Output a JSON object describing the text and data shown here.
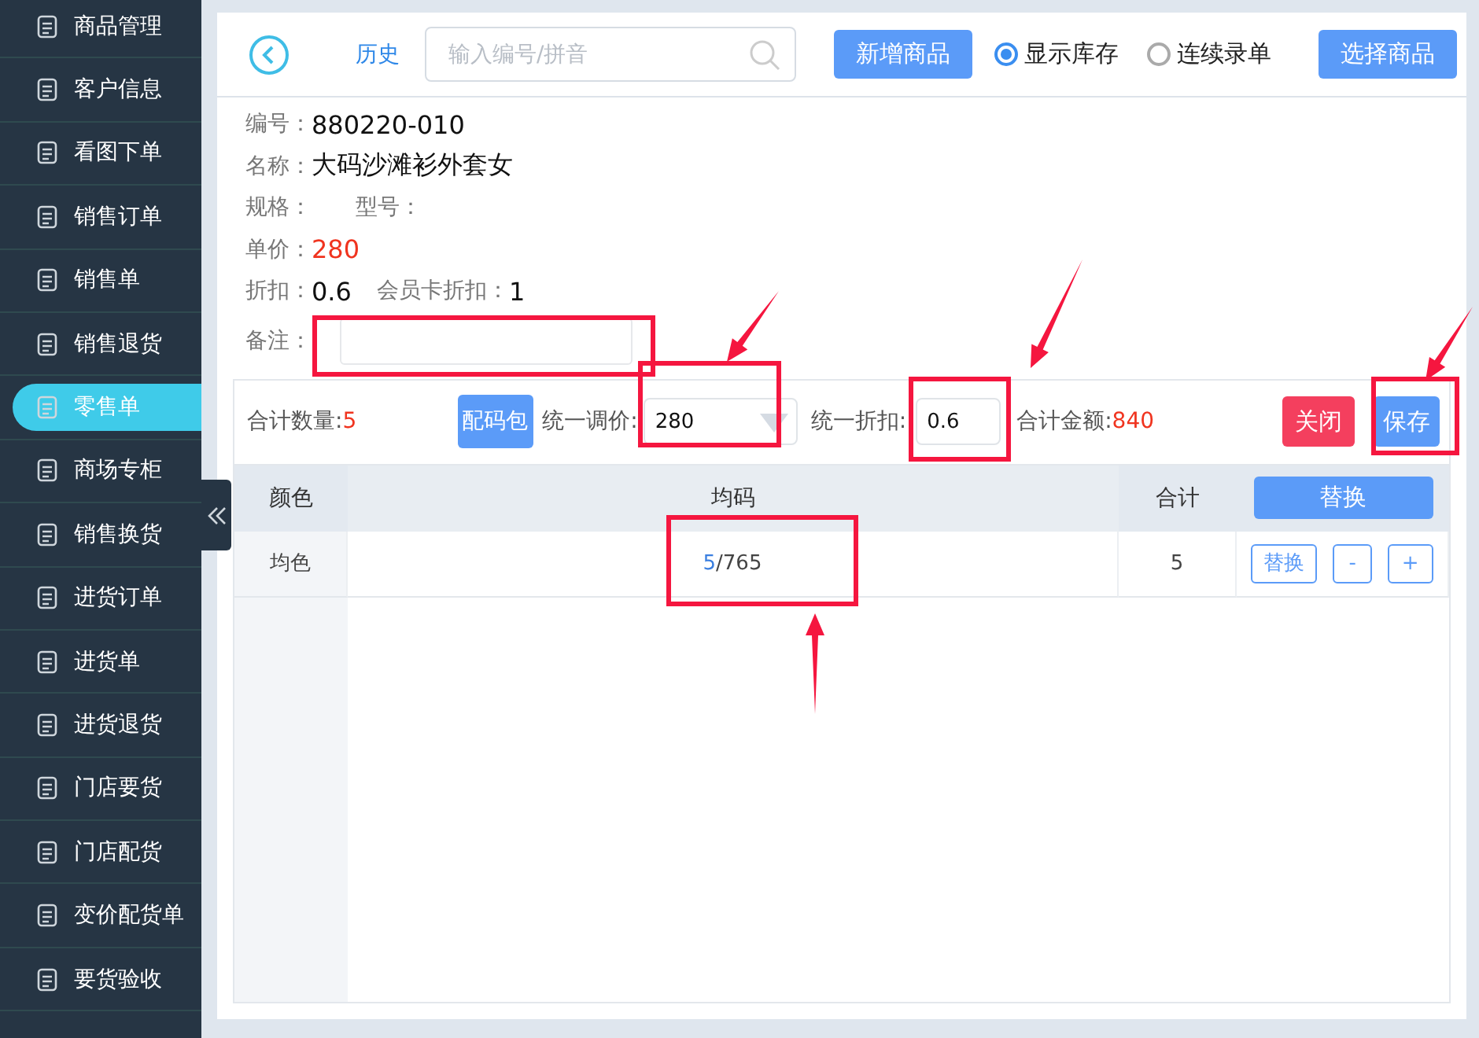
{
  "sidebar": {
    "items": [
      {
        "label": "商品管理",
        "selected": false
      },
      {
        "label": "客户信息",
        "selected": false
      },
      {
        "label": "看图下单",
        "selected": false
      },
      {
        "label": "销售订单",
        "selected": false
      },
      {
        "label": "销售单",
        "selected": false
      },
      {
        "label": "销售退货",
        "selected": false
      },
      {
        "label": "零售单",
        "selected": true
      },
      {
        "label": "商场专柜",
        "selected": false
      },
      {
        "label": "销售换货",
        "selected": false
      },
      {
        "label": "进货订单",
        "selected": false
      },
      {
        "label": "进货单",
        "selected": false
      },
      {
        "label": "进货退货",
        "selected": false
      },
      {
        "label": "门店要货",
        "selected": false
      },
      {
        "label": "门店配货",
        "selected": false
      },
      {
        "label": "变价配货单",
        "selected": false
      },
      {
        "label": "要货验收",
        "selected": false
      }
    ]
  },
  "header": {
    "history_link": "历史",
    "search": {
      "placeholder": "输入编号/拼音"
    },
    "add_button": "新增商品",
    "options": [
      {
        "label": "显示库存",
        "selected": true
      },
      {
        "label": "连续录单",
        "selected": false
      }
    ],
    "select_button": "选择商品"
  },
  "product": {
    "code": {
      "label": "编号：",
      "value": "880220-010"
    },
    "name": {
      "label": "名称：",
      "value": "大码沙滩衫外套女"
    },
    "spec": {
      "label": "规格："
    },
    "model": {
      "label": "型号："
    },
    "price": {
      "label": "单价：",
      "value": "280"
    },
    "discount": {
      "label": "折扣：",
      "value": "0.6"
    },
    "member_discount": {
      "label": "会员卡折扣：",
      "value": "1"
    },
    "remark": {
      "label": "备注："
    }
  },
  "toolbar": {
    "total_qty": {
      "label": "合计数量:",
      "value": "5"
    },
    "size_pack_button": "配码包",
    "unified_price": {
      "label": "统一调价:",
      "value": "280"
    },
    "unified_discount": {
      "label": "统一折扣:",
      "value": "0.6"
    },
    "total_amount": {
      "label": "合计金额:",
      "value": "840"
    },
    "close_button": "关闭",
    "save_button": "保存"
  },
  "table": {
    "columns": [
      "颜色",
      "均码",
      "合计"
    ],
    "header_button": "替换",
    "rows": [
      {
        "color_name": "均色",
        "qty": "5",
        "stock": "/765",
        "total": "5",
        "replace_button": "替换",
        "minus_button": "-",
        "plus_button": "+"
      }
    ]
  }
}
